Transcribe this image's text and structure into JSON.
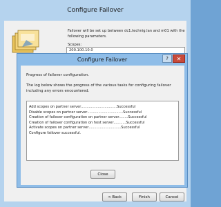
{
  "outer": {
    "title": "Configure Failover",
    "intro": "Failover will be set up between dc1.technig.lan and m01 with the following parameters.",
    "scopes_label": "Scopes:",
    "scopes_value": "200.100.10.0",
    "back_label": "< Back",
    "finish_label": "Finish",
    "cancel_label": "Cancel"
  },
  "dialog": {
    "title": "Configure Failover",
    "help_label": "?",
    "close_glyph": "✕",
    "progress_label": "Progress of failover configuration.",
    "log_description": "The log below shows the progress of the various tasks for configuring failover including any errors encountered.",
    "log": [
      {
        "task": "Add scopes on partner server",
        "dots": " ................................",
        "status": "Successful"
      },
      {
        "task": "Disable scopes on partner server",
        "dots": " ................................",
        "status": "Successful"
      },
      {
        "task": "Creation of failover configuration on partner server",
        "dots": " ........",
        "status": "Successful"
      },
      {
        "task": "Creation of failover configuration on host server",
        "dots": " ...........",
        "status": "Successful"
      },
      {
        "task": "Activate scopes on partner server",
        "dots": " .............................",
        "status": "Successful"
      },
      {
        "task": "Configure failover successful.",
        "dots": "",
        "status": ""
      }
    ],
    "close_label": "Close"
  }
}
